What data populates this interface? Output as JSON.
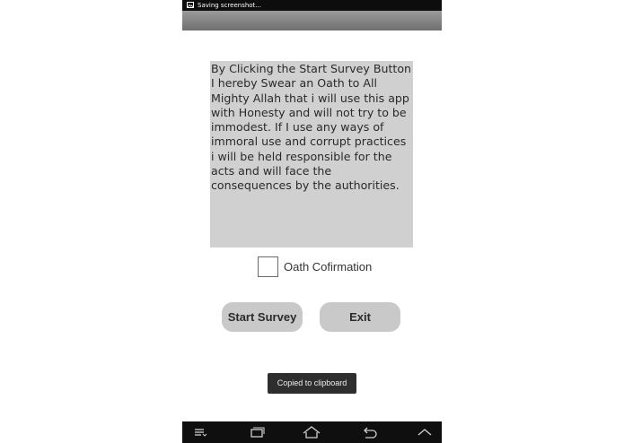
{
  "status_bar": {
    "notification_icon": "image-icon",
    "text": "Saving screenshot..."
  },
  "oath": {
    "text": "By Clicking the Start Survey Button I hereby Swear an Oath to All Mighty Allah that i will use this app with Honesty and will not try to be immodest. If I use any ways of immoral use and corrupt practices i will be held responsible for the acts and will face the consequences by the authorities."
  },
  "checkbox": {
    "label": "Oath Cofirmation",
    "checked": false
  },
  "buttons": {
    "start_label": "Start Survey",
    "exit_label": "Exit"
  },
  "toast": {
    "text": "Copied to clipboard"
  },
  "nav_bar": {
    "icons": [
      "menu-icon",
      "recent-apps-icon",
      "home-icon",
      "back-icon",
      "up-chevron-icon"
    ]
  },
  "colors": {
    "status_bar": "#0d0d0d",
    "oath_box": "#d0d0d0",
    "button": "#c9c9c9",
    "toast": "#2e2e2e",
    "nav_bar": "#0f0f0f"
  }
}
